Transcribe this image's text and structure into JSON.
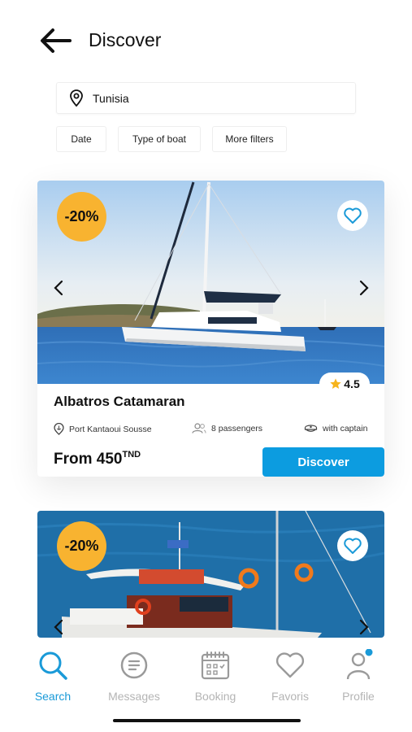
{
  "header": {
    "title": "Discover"
  },
  "search": {
    "value": "Tunisia"
  },
  "filters": [
    "Date",
    "Type of boat",
    "More filters"
  ],
  "listings": [
    {
      "discount": "-20%",
      "rating": "4.5",
      "name": "Albatros Catamaran",
      "location": "Port Kantaoui Sousse",
      "passengers": "8 passengers",
      "captain": "with captain",
      "price_prefix": "From 450",
      "currency": "TND",
      "cta": "Discover"
    },
    {
      "discount": "-20%"
    }
  ],
  "tabs": [
    {
      "label": "Search",
      "icon": "search-icon",
      "active": true
    },
    {
      "label": "Messages",
      "icon": "message-icon",
      "active": false
    },
    {
      "label": "Booking",
      "icon": "calendar-icon",
      "active": false
    },
    {
      "label": "Favoris",
      "icon": "heart-icon",
      "active": false
    },
    {
      "label": "Profile",
      "icon": "user-icon",
      "active": false,
      "notification_dot": true
    }
  ],
  "colors": {
    "accent": "#0c9ce0",
    "active_tab": "#1a9ad8",
    "inactive_tab": "#b4b4b4",
    "discount_badge": "#f8b330",
    "star": "#f6b41c"
  }
}
